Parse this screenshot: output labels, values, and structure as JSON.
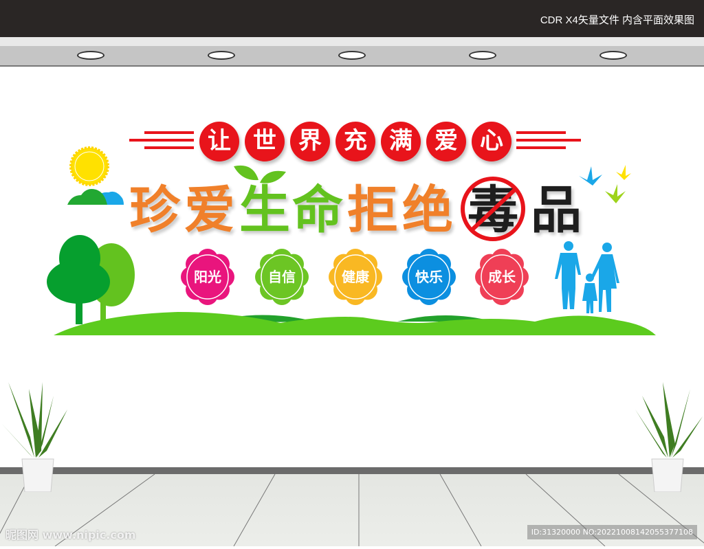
{
  "header": {
    "caption": "CDR X4矢量文件  内含平面效果图"
  },
  "slogan": {
    "chars": [
      "让",
      "世",
      "界",
      "充",
      "满",
      "爱",
      "心"
    ]
  },
  "title": {
    "chars": [
      "珍",
      "爱",
      "生",
      "命",
      "拒",
      "绝",
      "毒",
      "品"
    ],
    "colors": {
      "orange": "#f0802a",
      "green": "#63c21f",
      "black": "#1e1e1e",
      "red": "#e8141b"
    }
  },
  "values": [
    {
      "label": "阳光",
      "color": "#e9157d"
    },
    {
      "label": "自信",
      "color": "#6cc524"
    },
    {
      "label": "健康",
      "color": "#f9b823"
    },
    {
      "label": "快乐",
      "color": "#0c8fe0"
    },
    {
      "label": "成长",
      "color": "#ef3f56"
    }
  ],
  "watermark": {
    "logo": "昵图网 www.nipic.com",
    "id": "ID:31320000 NO:20221008142055377108"
  }
}
